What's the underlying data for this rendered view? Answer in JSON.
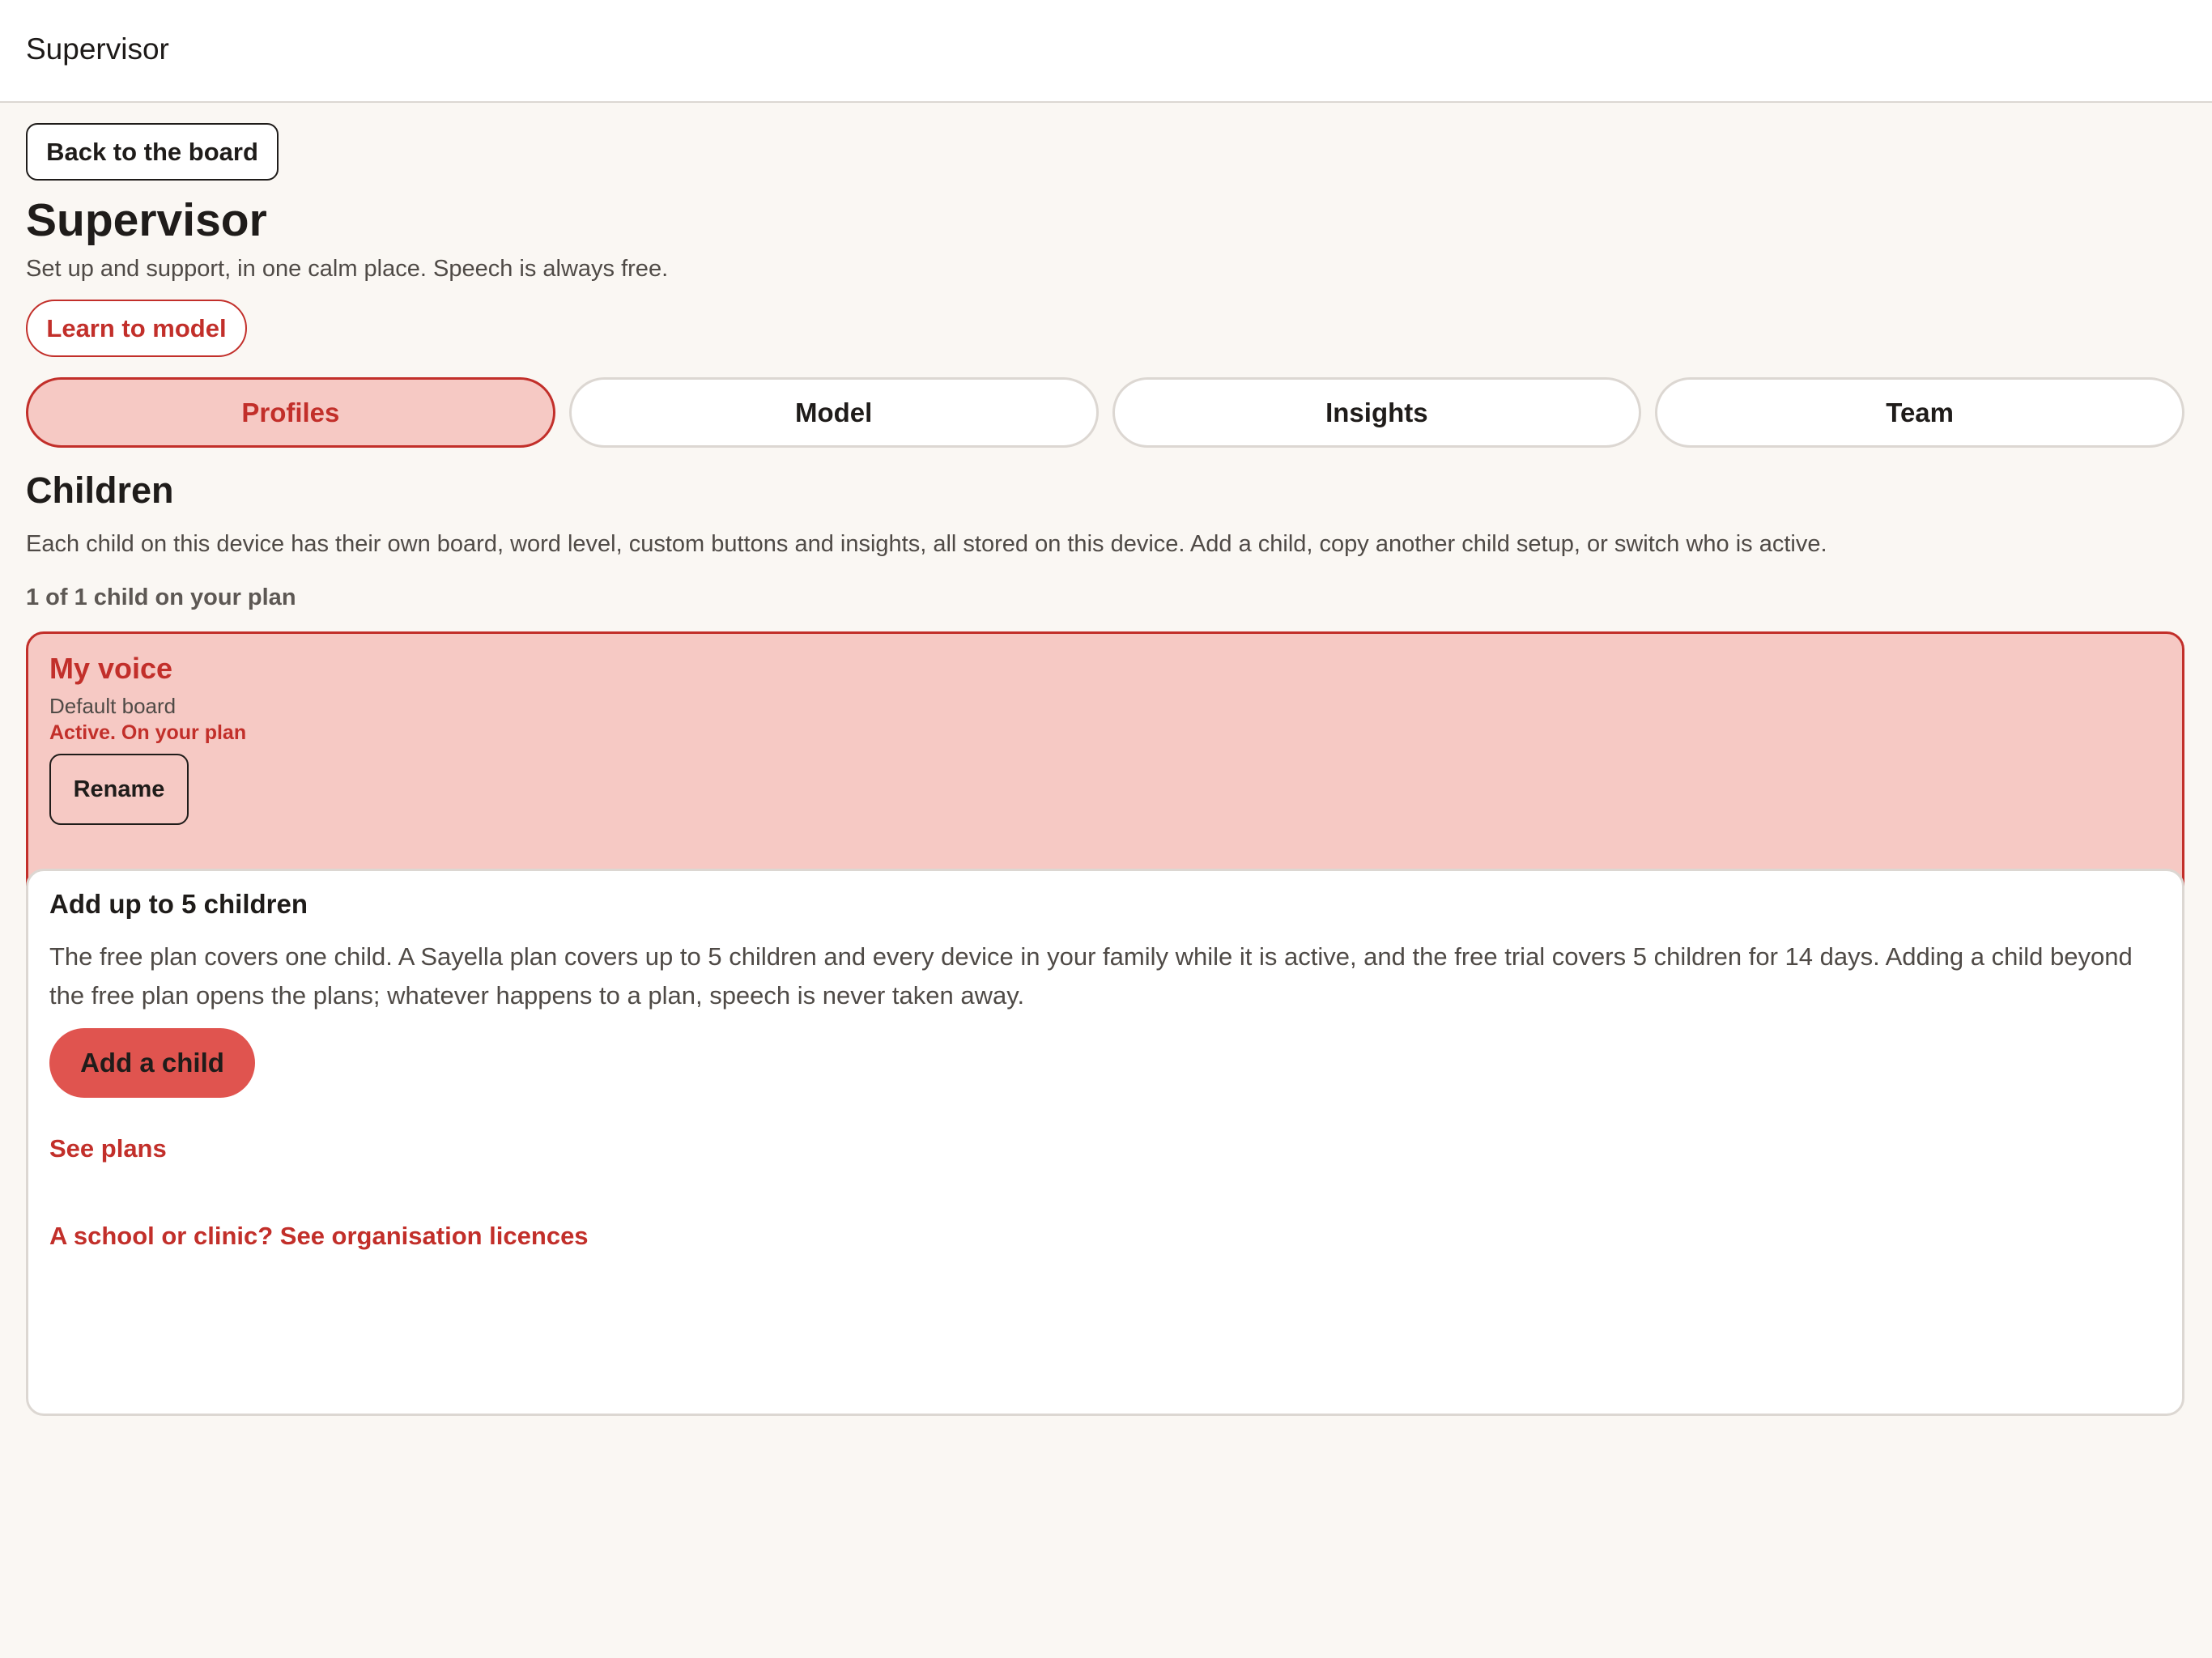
{
  "topbar": {
    "title": "Supervisor"
  },
  "header": {
    "back_label": "Back to the board",
    "title": "Supervisor",
    "subtitle": "Set up and support, in one calm place. Speech is always free.",
    "learn_label": "Learn to model"
  },
  "tabs": [
    {
      "label": "Profiles",
      "active": true
    },
    {
      "label": "Model",
      "active": false
    },
    {
      "label": "Insights",
      "active": false
    },
    {
      "label": "Team",
      "active": false
    }
  ],
  "children": {
    "title": "Children",
    "description": "Each child on this device has their own board, word level, custom buttons and insights, all stored on this device. Add a child, copy another child setup, or switch who is active.",
    "plan_count": "1 of 1 child on your plan",
    "profile": {
      "name": "My voice",
      "board": "Default board",
      "status": "Active. On your plan",
      "rename_label": "Rename"
    }
  },
  "add_card": {
    "heading": "Add up to 5 children",
    "body": "The free plan covers one child. A Sayella plan covers up to 5 children and every device in your family while it is active, and the free trial covers 5 children for 14 days. Adding a child beyond the free plan opens the plans; whatever happens to a plan, speech is never taken away.",
    "add_label": "Add a child",
    "plans_link": "See plans",
    "org_link": "A school or clinic? See organisation licences"
  },
  "colors": {
    "accent": "#c22f2a",
    "accent_fill": "#f6c9c4",
    "primary_button": "#e0544f",
    "background": "#faf7f3"
  }
}
